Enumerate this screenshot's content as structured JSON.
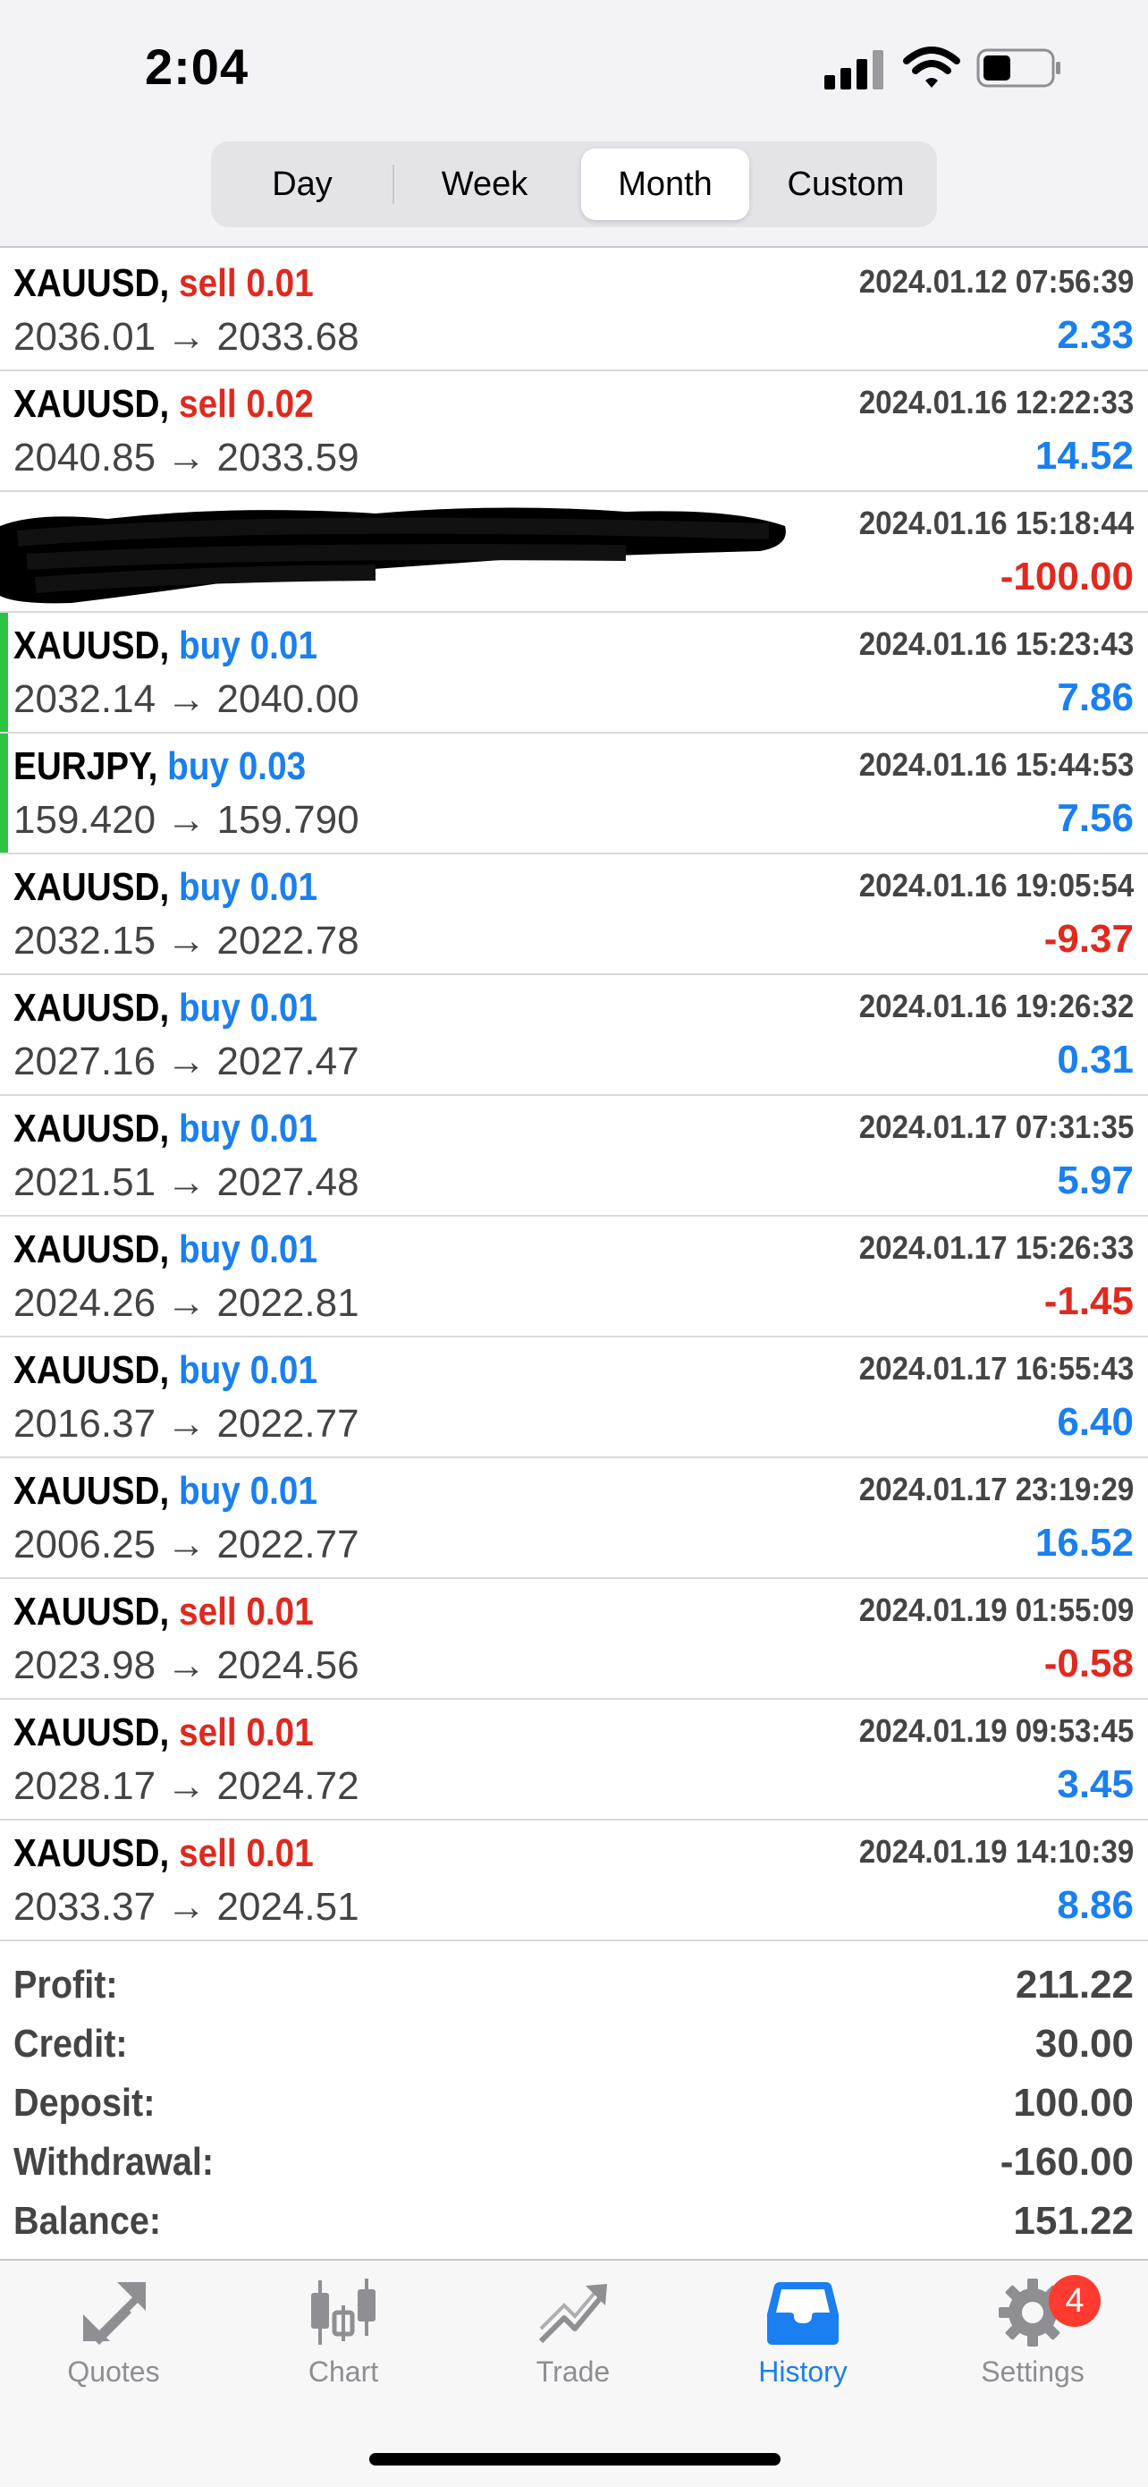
{
  "status_bar": {
    "time": "2:04"
  },
  "period_tabs": [
    {
      "label": "Day",
      "active": false
    },
    {
      "label": "Week",
      "active": false
    },
    {
      "label": "Month",
      "active": true
    },
    {
      "label": "Custom",
      "active": false
    }
  ],
  "trades": [
    {
      "symbol": "XAUUSD,",
      "side": "sell 0.01",
      "prices": "2036.01 → 2033.68",
      "date": "2024.01.12 07:56:39",
      "profit": "2.33"
    },
    {
      "symbol": "XAUUSD,",
      "side": "sell 0.02",
      "prices": "2040.85 → 2033.59",
      "date": "2024.01.16 12:22:33",
      "profit": "14.52"
    },
    {
      "symbol": "",
      "side": "",
      "prices": "",
      "date": "2024.01.16 15:18:44",
      "profit": "-100.00"
    },
    {
      "symbol": "XAUUSD,",
      "side": "buy 0.01",
      "prices": "2032.14 → 2040.00",
      "date": "2024.01.16 15:23:43",
      "profit": "7.86"
    },
    {
      "symbol": "EURJPY,",
      "side": "buy 0.03",
      "prices": "159.420 → 159.790",
      "date": "2024.01.16 15:44:53",
      "profit": "7.56"
    },
    {
      "symbol": "XAUUSD,",
      "side": "buy 0.01",
      "prices": "2032.15 → 2022.78",
      "date": "2024.01.16 19:05:54",
      "profit": "-9.37"
    },
    {
      "symbol": "XAUUSD,",
      "side": "buy 0.01",
      "prices": "2027.16 → 2027.47",
      "date": "2024.01.16 19:26:32",
      "profit": "0.31"
    },
    {
      "symbol": "XAUUSD,",
      "side": "buy 0.01",
      "prices": "2021.51 → 2027.48",
      "date": "2024.01.17 07:31:35",
      "profit": "5.97"
    },
    {
      "symbol": "XAUUSD,",
      "side": "buy 0.01",
      "prices": "2024.26 → 2022.81",
      "date": "2024.01.17 15:26:33",
      "profit": "-1.45"
    },
    {
      "symbol": "XAUUSD,",
      "side": "buy 0.01",
      "prices": "2016.37 → 2022.77",
      "date": "2024.01.17 16:55:43",
      "profit": "6.40"
    },
    {
      "symbol": "XAUUSD,",
      "side": "buy 0.01",
      "prices": "2006.25 → 2022.77",
      "date": "2024.01.17 23:19:29",
      "profit": "16.52"
    },
    {
      "symbol": "XAUUSD,",
      "side": "sell 0.01",
      "prices": "2023.98 → 2024.56",
      "date": "2024.01.19 01:55:09",
      "profit": "-0.58"
    },
    {
      "symbol": "XAUUSD,",
      "side": "sell 0.01",
      "prices": "2028.17 → 2024.72",
      "date": "2024.01.19 09:53:45",
      "profit": "3.45"
    },
    {
      "symbol": "XAUUSD,",
      "side": "sell 0.01",
      "prices": "2033.37 → 2024.51",
      "date": "2024.01.19 14:10:39",
      "profit": "8.86"
    }
  ],
  "summary": [
    {
      "label": "Profit:",
      "value": "211.22"
    },
    {
      "label": "Credit:",
      "value": "30.00"
    },
    {
      "label": "Deposit:",
      "value": "100.00"
    },
    {
      "label": "Withdrawal:",
      "value": "-160.00"
    },
    {
      "label": "Balance:",
      "value": "151.22"
    }
  ],
  "tabbar": {
    "items": [
      {
        "label": "Quotes",
        "icon": "quotes-icon"
      },
      {
        "label": "Chart",
        "icon": "chart-icon"
      },
      {
        "label": "Trade",
        "icon": "trade-icon"
      },
      {
        "label": "History",
        "icon": "history-icon"
      },
      {
        "label": "Settings",
        "icon": "gear-icon"
      }
    ],
    "settings_badge": "4"
  },
  "colors": {
    "accent": "#1a7ff0",
    "negative": "#e0291f",
    "open_marker": "#2cc440"
  }
}
